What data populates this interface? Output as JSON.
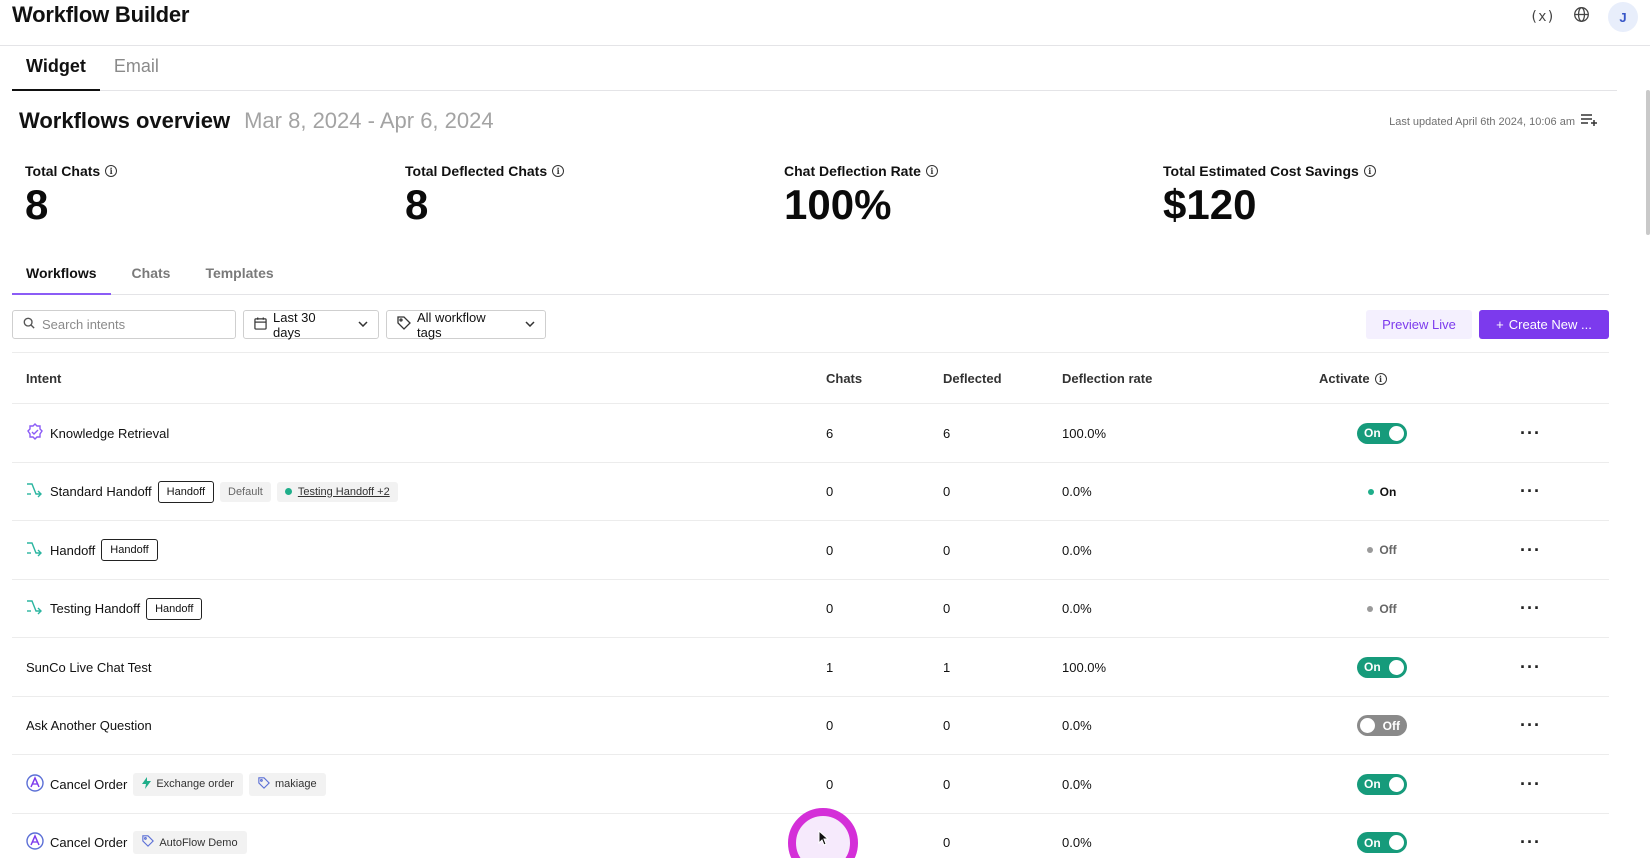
{
  "app": {
    "title": "Workflow Builder",
    "avatar_initial": "J",
    "var_label": "(x)"
  },
  "main_tabs": [
    {
      "label": "Widget"
    },
    {
      "label": "Email"
    }
  ],
  "overview": {
    "title": "Workflows overview",
    "date_range": "Mar 8, 2024 - Apr 6, 2024",
    "last_updated": "Last updated April 6th 2024, 10:06 am"
  },
  "stats": [
    {
      "label": "Total Chats",
      "value": "8"
    },
    {
      "label": "Total Deflected Chats",
      "value": "8"
    },
    {
      "label": "Chat Deflection Rate",
      "value": "100%"
    },
    {
      "label": "Total Estimated Cost Savings",
      "value": "$120"
    }
  ],
  "sub_tabs": [
    {
      "label": "Workflows"
    },
    {
      "label": "Chats"
    },
    {
      "label": "Templates"
    }
  ],
  "controls": {
    "search_placeholder": "Search intents",
    "date_filter": "Last 30 days",
    "tag_filter": "All workflow tags",
    "preview_label": "Preview Live",
    "create_label": "Create New ..."
  },
  "table": {
    "headers": {
      "intent": "Intent",
      "chats": "Chats",
      "deflected": "Deflected",
      "rate": "Deflection rate",
      "activate": "Activate"
    },
    "rows": [
      {
        "intent": "Knowledge Retrieval",
        "chats": "6",
        "deflected": "6",
        "rate": "100.0%",
        "status": "On"
      },
      {
        "intent": "Standard Handoff",
        "tag1": "Handoff",
        "tag2": "Default",
        "tag3": "Testing Handoff +2",
        "chats": "0",
        "deflected": "0",
        "rate": "0.0%",
        "status": "On"
      },
      {
        "intent": "Handoff",
        "tag1": "Handoff",
        "chats": "0",
        "deflected": "0",
        "rate": "0.0%",
        "status": "Off"
      },
      {
        "intent": "Testing Handoff",
        "tag1": "Handoff",
        "chats": "0",
        "deflected": "0",
        "rate": "0.0%",
        "status": "Off"
      },
      {
        "intent": "SunCo Live Chat Test",
        "chats": "1",
        "deflected": "1",
        "rate": "100.0%",
        "status": "On"
      },
      {
        "intent": "Ask Another Question",
        "chats": "0",
        "deflected": "0",
        "rate": "0.0%",
        "status": "Off"
      },
      {
        "intent": "Cancel Order",
        "tag1": "Exchange order",
        "tag2": "makiage",
        "chats": "0",
        "deflected": "0",
        "rate": "0.0%",
        "status": "On"
      },
      {
        "intent": "Cancel Order",
        "tag1": "AutoFlow Demo",
        "chats": "",
        "deflected": "0",
        "rate": "0.0%",
        "status": "On"
      }
    ]
  },
  "colors": {
    "accent": "#7c3aed",
    "toggle_on": "#169b7b",
    "toggle_off": "#8a8a8a",
    "handoff_icon": "#2bb5a0"
  }
}
